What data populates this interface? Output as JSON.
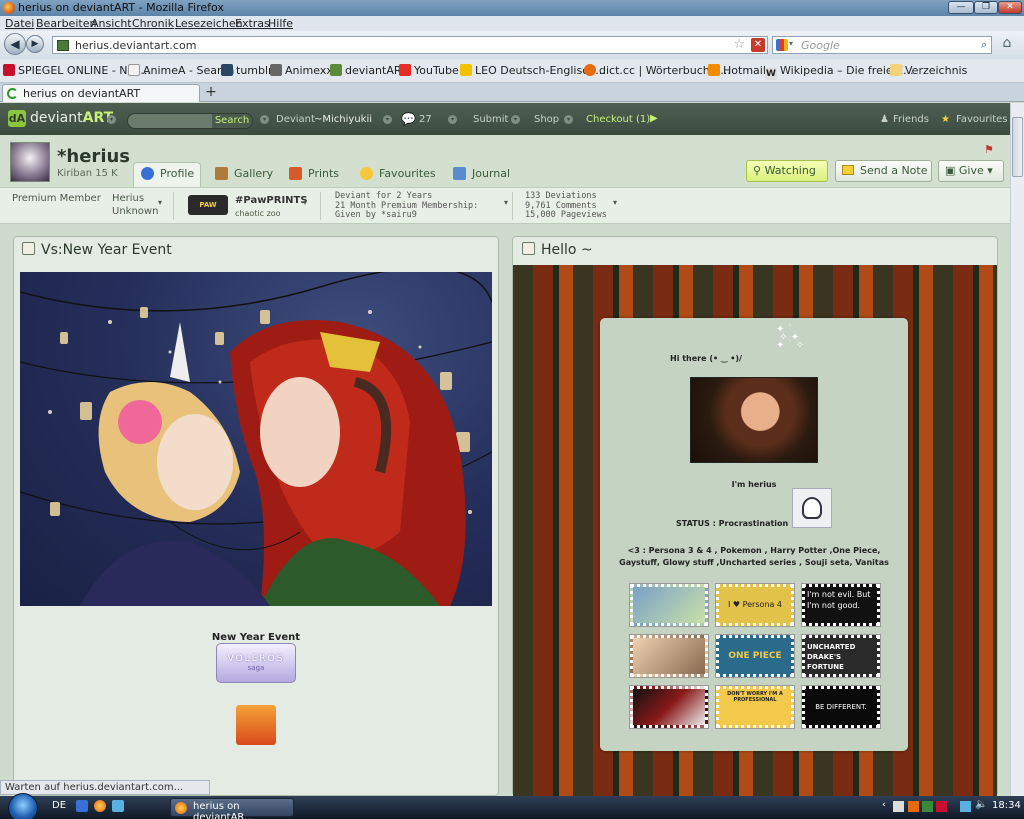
{
  "window": {
    "title": "herius on deviantART - Mozilla Firefox",
    "min": "—",
    "max": "❐",
    "close": "✕"
  },
  "menu": [
    "Datei",
    "Bearbeiten",
    "Ansicht",
    "Chronik",
    "Lesezeichen",
    "Extras",
    "Hilfe"
  ],
  "nav": {
    "url": "herius.deviantart.com",
    "search_placeholder": "Google"
  },
  "bookmarks": [
    {
      "label": "SPIEGEL ONLINE - Nac...",
      "color": "#c8102e"
    },
    {
      "label": "AnimeA - Search",
      "color": "#f2f2f2"
    },
    {
      "label": "tumblr",
      "color": "#2c4762"
    },
    {
      "label": "Animexx",
      "color": "#666666"
    },
    {
      "label": "deviantART",
      "color": "#5a8a3a"
    },
    {
      "label": "YouTube",
      "color": "#e52d27"
    },
    {
      "label": "LEO Deutsch-Englisch...",
      "color": "#f2c200"
    },
    {
      "label": "dict.cc | Wörterbuch E...",
      "color": "#e86a10"
    },
    {
      "label": "Hotmail",
      "color": "#f28c00"
    },
    {
      "label": "Wikipedia – Die freie E...",
      "color": "#dddddd"
    },
    {
      "label": "Verzeichnis",
      "color": "#f3d27a"
    }
  ],
  "tab": {
    "label": "herius on deviantART",
    "new": "+"
  },
  "da": {
    "logo_a": "deviant",
    "logo_b": "ART",
    "search_btn": "Search",
    "user_prefix": "Deviant",
    "user": "~Michiyukii",
    "notes_count": "27",
    "submit": "Submit",
    "shop": "Shop",
    "checkout": "Checkout (1)",
    "friends": "Friends",
    "favourites": "Favourites"
  },
  "profile": {
    "name": "*herius",
    "sub": "Kiriban 15 K",
    "tabs": [
      "Profile",
      "Gallery",
      "Prints",
      "Favourites",
      "Journal"
    ],
    "watching": "Watching",
    "send_note": "Send a Note",
    "give": "Give"
  },
  "info": {
    "premium": "Premium Member",
    "nick": "Herius",
    "status": "Unknown",
    "group": "#PawPRINTS",
    "group_sub": "chaotic zoo",
    "group_logo": "PAW",
    "deviant_for": "Deviant for 2 Years",
    "membership": "21 Month Premium Membership:",
    "given_by": "Given by *sairu9",
    "deviations": "133 Deviations",
    "comments": "9,761 Comments",
    "pageviews": "15,000 Pageviews"
  },
  "left_panel": {
    "title": "Vs:New Year Event",
    "caption": "New Year Event",
    "badge": "VOLEROS",
    "badge_sub": "saga"
  },
  "right_panel": {
    "title": "Hello ~",
    "greeting": "Hi there (• ‿ •)/",
    "im": "I'm herius",
    "status": "STATUS : Procrastination",
    "likes1": "<3 : Persona 3 & 4 , Pokemon , Harry Potter ,One Piece,",
    "likes2": "Gaystuff, Glowy stuff ,Uncharted series , Souji seta, Vanitas",
    "stamps": [
      {
        "text": "",
        "bg": "#7aa0c8"
      },
      {
        "text": "I ♥ Persona 4",
        "bg": "#e3c24a"
      },
      {
        "text": "I'm not evil. But I'm not good.",
        "bg": "#111111"
      },
      {
        "text": "",
        "bg": "#8a6a50"
      },
      {
        "text": "ONE PIECE",
        "bg": "#2a6a8a"
      },
      {
        "text": "UNCHARTED DRAKE'S FORTUNE",
        "bg": "#2a2a2a"
      },
      {
        "text": "",
        "bg": "#3a1a1a"
      },
      {
        "text": "DON'T WORRY I'M A PROFESSIONAL",
        "bg": "#f2c94a"
      },
      {
        "text": "BE DIFFERENT.",
        "bg": "#0a0a0a"
      }
    ]
  },
  "status": "Warten auf herius.deviantart.com...",
  "taskbar": {
    "lang": "DE",
    "item": "herius on deviantAR...",
    "time": "18:34"
  }
}
